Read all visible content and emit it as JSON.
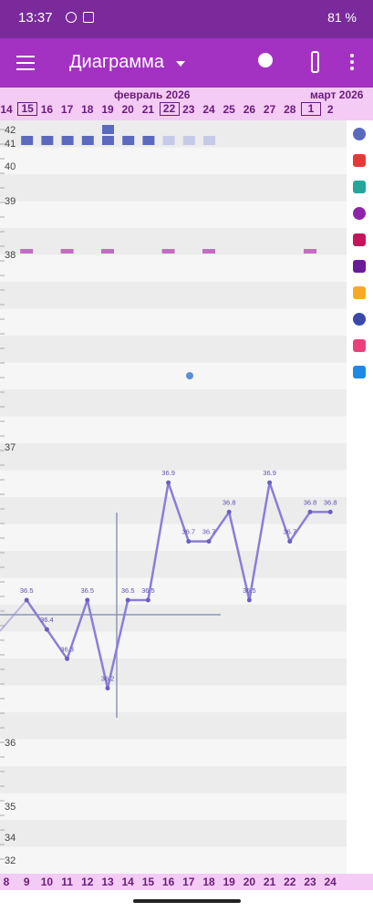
{
  "status": {
    "time": "13:37",
    "battery": "81 %"
  },
  "appbar": {
    "title": "Диаграмма"
  },
  "dates": {
    "month_left": "февраль 2026",
    "month_right": "март 2026",
    "days": [
      "14",
      "15",
      "16",
      "17",
      "18",
      "19",
      "20",
      "21",
      "22",
      "23",
      "24",
      "25",
      "26",
      "27",
      "28",
      "1",
      "2"
    ],
    "boxed": [
      "15",
      "22",
      "1"
    ]
  },
  "bottom_days": [
    "8",
    "9",
    "10",
    "11",
    "12",
    "13",
    "14",
    "15",
    "16",
    "17",
    "18",
    "19",
    "20",
    "21",
    "22",
    "23",
    "24"
  ],
  "sidebar_icons": [
    "flower-icon",
    "drop-icon",
    "splash-icon",
    "rings-icon",
    "heart-icon",
    "leaf-icon",
    "pill-icon",
    "smiley-icon",
    "lipstick-icon",
    "document-icon"
  ],
  "chart_data": {
    "type": "line",
    "y_tick_labels": [
      "42",
      "41",
      "40",
      "39",
      "38",
      "37",
      "36",
      "35",
      "34",
      "32"
    ],
    "x_tick_labels": [
      "8",
      "9",
      "10",
      "11",
      "12",
      "13",
      "14",
      "15",
      "16",
      "17",
      "18",
      "19",
      "20",
      "21",
      "22",
      "23",
      "24"
    ],
    "series": [
      {
        "x": [
          "9",
          "10",
          "11",
          "12",
          "13",
          "14",
          "15",
          "16",
          "17",
          "18",
          "19",
          "20",
          "21",
          "22",
          "23",
          "24"
        ],
        "values": [
          36.5,
          36.4,
          36.3,
          36.5,
          36.2,
          36.5,
          36.5,
          36.9,
          36.7,
          36.7,
          36.8,
          36.5,
          36.9,
          36.7,
          36.8,
          36.8
        ],
        "labels": [
          "36.5",
          "36.4",
          "36.3",
          "36.5",
          "36.2",
          "36.5",
          "36.5",
          "36.9",
          "36.7",
          "36.7",
          "36.8",
          "36.5",
          "36.9",
          "36.7",
          "36.8",
          "36.8"
        ]
      }
    ],
    "colors": {
      "line": "#8a7ed8",
      "bleed": "#5b6abf",
      "bleed_light": "#c5cae9",
      "mucus": "#c26ec0",
      "dot": "#5b8fd6"
    }
  }
}
